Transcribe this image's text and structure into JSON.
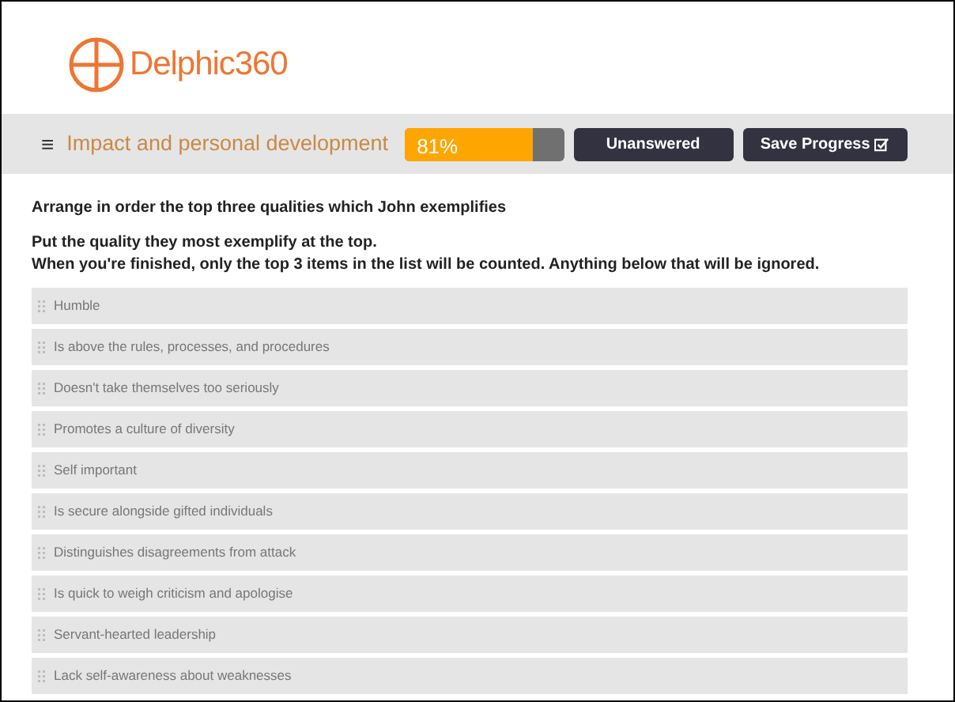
{
  "logo": {
    "text": "Delphic360"
  },
  "toolbar": {
    "menu": "≡",
    "title": "Impact and personal development",
    "progress": {
      "text": "81%",
      "level": 0.81
    },
    "buttons": [
      {
        "label": "Unanswered",
        "kind": "plain"
      },
      {
        "label": "Save Progress",
        "kind": "save"
      }
    ]
  },
  "question": {
    "title": "Arrange in order the top three qualities which John exemplifies",
    "instructions": [
      "Put the quality they most exemplify at the top.",
      "When you're finished, only the top 3 items in the list will be counted. Anything below that will be ignored."
    ]
  },
  "items": [
    {
      "label": "Humble"
    },
    {
      "label": "Is above the rules, processes, and procedures"
    },
    {
      "label": "Doesn't take themselves too seriously"
    },
    {
      "label": "Promotes a culture of diversity"
    },
    {
      "label": "Self important"
    },
    {
      "label": "Is secure alongside gifted individuals"
    },
    {
      "label": "Distinguishes disagreements from attack"
    },
    {
      "label": "Is quick to weigh criticism and apologise"
    },
    {
      "label": "Servant-hearted leadership"
    },
    {
      "label": "Lack self-awareness about weaknesses"
    }
  ]
}
